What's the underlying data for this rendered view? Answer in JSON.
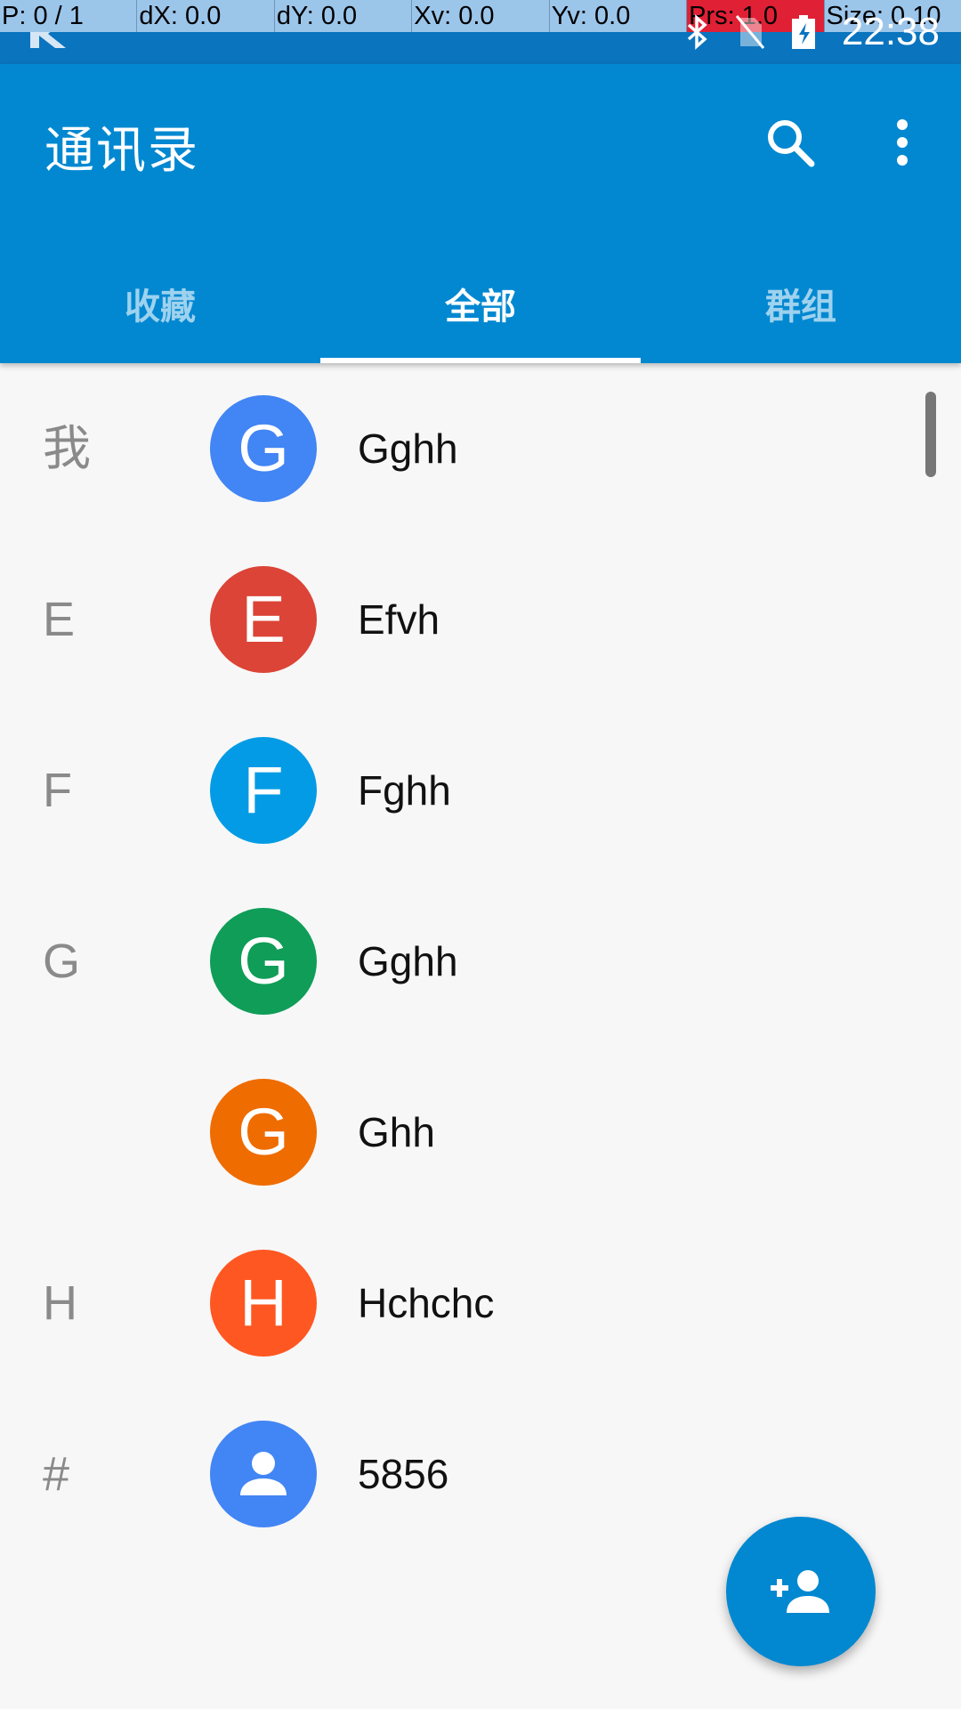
{
  "debug_overlay": {
    "pointer": "P: 0 / 1",
    "dx": "dX: 0.0",
    "dy": "dY: 0.0",
    "xv": "Xv: 0.0",
    "yv": "Yv: 0.0",
    "prs": "Prs: 1.0",
    "size": "Size: 0.10"
  },
  "status_bar": {
    "time": "22:38",
    "icons": [
      "app-logo-icon",
      "bluetooth-icon",
      "no-sim-icon",
      "battery-charging-icon"
    ]
  },
  "app_bar": {
    "title": "通讯录",
    "actions": [
      "search-icon",
      "more-vert-icon"
    ]
  },
  "tabs": [
    {
      "label": "收藏",
      "active": false
    },
    {
      "label": "全部",
      "active": true
    },
    {
      "label": "群组",
      "active": false
    }
  ],
  "contacts": [
    {
      "section": "我",
      "initial": "G",
      "name": "Gghh",
      "color": "#4285f4"
    },
    {
      "section": "E",
      "initial": "E",
      "name": "Efvh",
      "color": "#db4437"
    },
    {
      "section": "F",
      "initial": "F",
      "name": "Fghh",
      "color": "#039be5"
    },
    {
      "section": "G",
      "initial": "G",
      "name": "Gghh",
      "color": "#0f9d58"
    },
    {
      "section": "",
      "initial": "G",
      "name": "Ghh",
      "color": "#ef6c00"
    },
    {
      "section": "H",
      "initial": "H",
      "name": "Hchchc",
      "color": "#ff5722"
    },
    {
      "section": "#",
      "initial": "",
      "name": "5856",
      "color": "#4285f4",
      "icon": "person-icon"
    }
  ],
  "fab": {
    "icon": "add-person-icon",
    "color": "#0288d1"
  },
  "colors": {
    "primary": "#0288d1",
    "status": "#0a74be",
    "background": "#f7f7f7"
  }
}
